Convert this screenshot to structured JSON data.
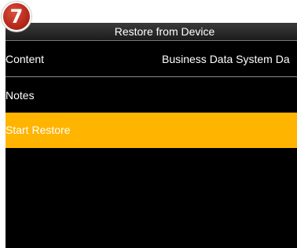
{
  "badge": {
    "number": "7",
    "color": "#b5281a"
  },
  "header": {
    "title": "Restore from Device"
  },
  "menu": {
    "content_label": "Content",
    "content_value": "Business Data System Da",
    "notes_label": "Notes",
    "start_restore_label": "Start Restore"
  },
  "colors": {
    "highlight": "#ffb400",
    "background": "#000000",
    "text": "#ffffff"
  }
}
